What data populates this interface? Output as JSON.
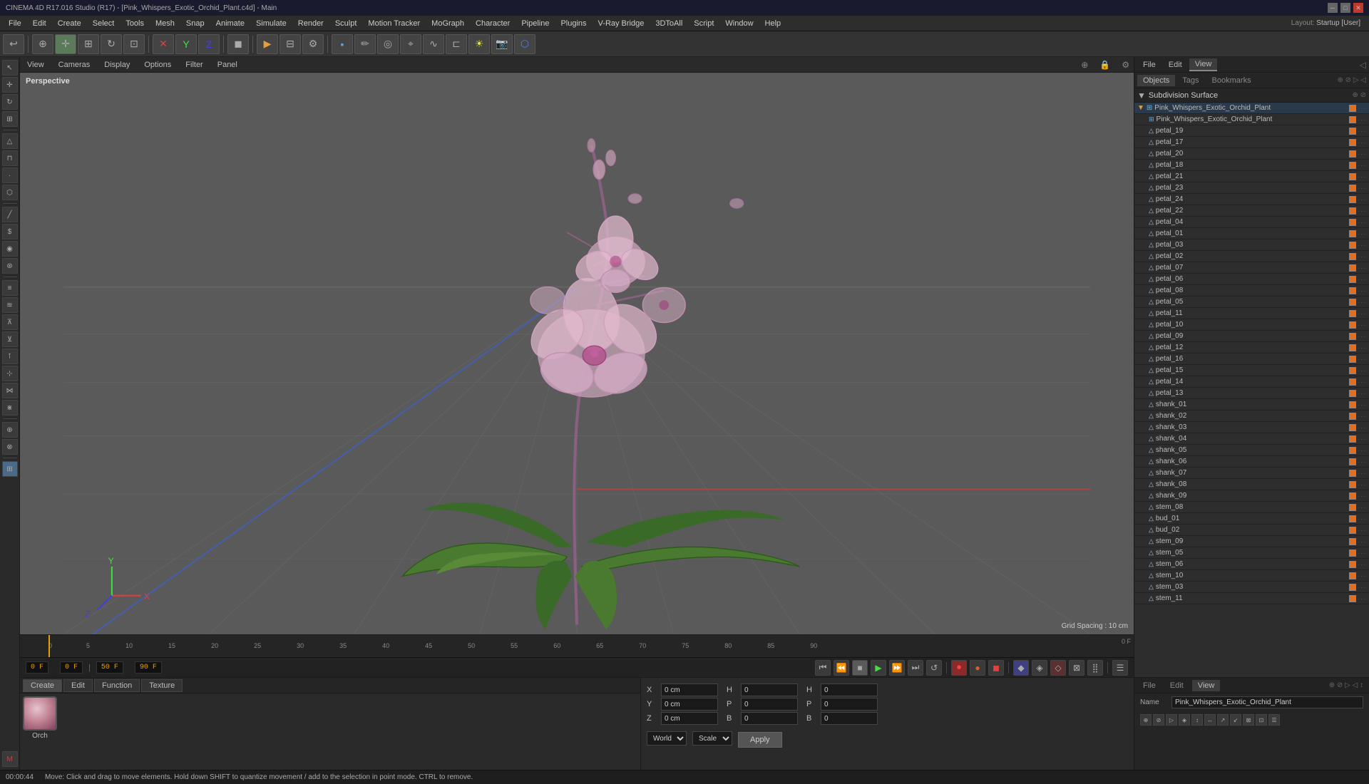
{
  "titleBar": {
    "title": "CINEMA 4D R17.016 Studio (R17) - [Pink_Whispers_Exotic_Orchid_Plant.c4d] - Main"
  },
  "menuBar": {
    "items": [
      "File",
      "Edit",
      "Create",
      "Select",
      "Tools",
      "Mesh",
      "Snap",
      "Animate",
      "Simulate",
      "Render",
      "Sculpt",
      "Motion Tracker",
      "MoGraph",
      "Character",
      "Pipeline",
      "Plugins",
      "V-Ray Bridge",
      "3DToAll",
      "Script",
      "Window",
      "Help"
    ]
  },
  "viewport": {
    "label": "Perspective",
    "gridSpacing": "Grid Spacing : 10 cm",
    "viewMenuItems": [
      "View",
      "Cameras",
      "Display",
      "Options",
      "Filter",
      "Panel"
    ]
  },
  "timeline": {
    "markers": [
      0,
      5,
      10,
      15,
      20,
      25,
      30,
      35,
      40,
      45,
      50,
      55,
      60,
      65,
      70,
      75,
      80,
      85,
      90
    ],
    "frameDisplay": "0 F",
    "startFrame": "0 F",
    "endFrame": "90 F",
    "fps": "50 F",
    "currentFrame": "0"
  },
  "transport": {
    "timeStart": "00:00:44"
  },
  "objectTabs": [
    "Create",
    "Edit",
    "Function",
    "Texture"
  ],
  "material": {
    "name": "Orch"
  },
  "coords": {
    "x": {
      "label": "X",
      "value": "0 cm",
      "hLabel": "H",
      "hValue": "0"
    },
    "y": {
      "label": "Y",
      "value": "0 cm",
      "pLabel": "P",
      "pValue": "0"
    },
    "z": {
      "label": "Z",
      "value": "0 cm",
      "bLabel": "B",
      "bValue": "0"
    },
    "coordSystem": "World",
    "scaleMode": "Scale"
  },
  "applyBtn": "Apply",
  "rightPanel": {
    "tabs": [
      "File",
      "Edit",
      "View"
    ],
    "subHeader": {
      "items": [
        "Objects",
        "Tags",
        "Bookmarks"
      ]
    },
    "topItem": "Subdivision Surface",
    "objects": [
      {
        "name": "Pink_Whispers_Exotic_Orchid_Plant",
        "indent": 1,
        "type": "group"
      },
      {
        "name": "petal_19",
        "indent": 2,
        "type": "mesh"
      },
      {
        "name": "petal_17",
        "indent": 2,
        "type": "mesh"
      },
      {
        "name": "petal_20",
        "indent": 2,
        "type": "mesh"
      },
      {
        "name": "petal_18",
        "indent": 2,
        "type": "mesh"
      },
      {
        "name": "petal_21",
        "indent": 2,
        "type": "mesh"
      },
      {
        "name": "petal_23",
        "indent": 2,
        "type": "mesh"
      },
      {
        "name": "petal_24",
        "indent": 2,
        "type": "mesh"
      },
      {
        "name": "petal_22",
        "indent": 2,
        "type": "mesh"
      },
      {
        "name": "petal_04",
        "indent": 2,
        "type": "mesh"
      },
      {
        "name": "petal_01",
        "indent": 2,
        "type": "mesh"
      },
      {
        "name": "petal_03",
        "indent": 2,
        "type": "mesh"
      },
      {
        "name": "petal_02",
        "indent": 2,
        "type": "mesh"
      },
      {
        "name": "petal_07",
        "indent": 2,
        "type": "mesh"
      },
      {
        "name": "petal_06",
        "indent": 2,
        "type": "mesh"
      },
      {
        "name": "petal_08",
        "indent": 2,
        "type": "mesh"
      },
      {
        "name": "petal_05",
        "indent": 2,
        "type": "mesh"
      },
      {
        "name": "petal_11",
        "indent": 2,
        "type": "mesh"
      },
      {
        "name": "petal_10",
        "indent": 2,
        "type": "mesh"
      },
      {
        "name": "petal_09",
        "indent": 2,
        "type": "mesh"
      },
      {
        "name": "petal_12",
        "indent": 2,
        "type": "mesh"
      },
      {
        "name": "petal_16",
        "indent": 2,
        "type": "mesh"
      },
      {
        "name": "petal_15",
        "indent": 2,
        "type": "mesh"
      },
      {
        "name": "petal_14",
        "indent": 2,
        "type": "mesh"
      },
      {
        "name": "petal_13",
        "indent": 2,
        "type": "mesh"
      },
      {
        "name": "shank_01",
        "indent": 2,
        "type": "mesh"
      },
      {
        "name": "shank_02",
        "indent": 2,
        "type": "mesh"
      },
      {
        "name": "shank_03",
        "indent": 2,
        "type": "mesh"
      },
      {
        "name": "shank_04",
        "indent": 2,
        "type": "mesh"
      },
      {
        "name": "shank_05",
        "indent": 2,
        "type": "mesh"
      },
      {
        "name": "shank_06",
        "indent": 2,
        "type": "mesh"
      },
      {
        "name": "shank_07",
        "indent": 2,
        "type": "mesh"
      },
      {
        "name": "shank_08",
        "indent": 2,
        "type": "mesh"
      },
      {
        "name": "shank_09",
        "indent": 2,
        "type": "mesh"
      },
      {
        "name": "stem_08",
        "indent": 2,
        "type": "mesh"
      },
      {
        "name": "bud_01",
        "indent": 2,
        "type": "mesh"
      },
      {
        "name": "bud_02",
        "indent": 2,
        "type": "mesh"
      },
      {
        "name": "stem_09",
        "indent": 2,
        "type": "mesh"
      },
      {
        "name": "stem_05",
        "indent": 2,
        "type": "mesh"
      },
      {
        "name": "stem_06",
        "indent": 2,
        "type": "mesh"
      },
      {
        "name": "stem_10",
        "indent": 2,
        "type": "mesh"
      },
      {
        "name": "stem_03",
        "indent": 2,
        "type": "mesh"
      },
      {
        "name": "stem_11",
        "indent": 2,
        "type": "mesh"
      }
    ]
  },
  "bottomRight": {
    "tabs": [
      "File",
      "Edit",
      "View"
    ],
    "nameLabel": "Name",
    "nameValue": "Pink_Whispers_Exotic_Orchid_Plant"
  },
  "statusBar": {
    "time": "00:00:44",
    "message": "Move: Click and drag to move elements. Hold down SHIFT to quantize movement / add to the selection in point mode. CTRL to remove."
  },
  "layout": {
    "label": "Layout:",
    "value": "Startup [User]"
  }
}
